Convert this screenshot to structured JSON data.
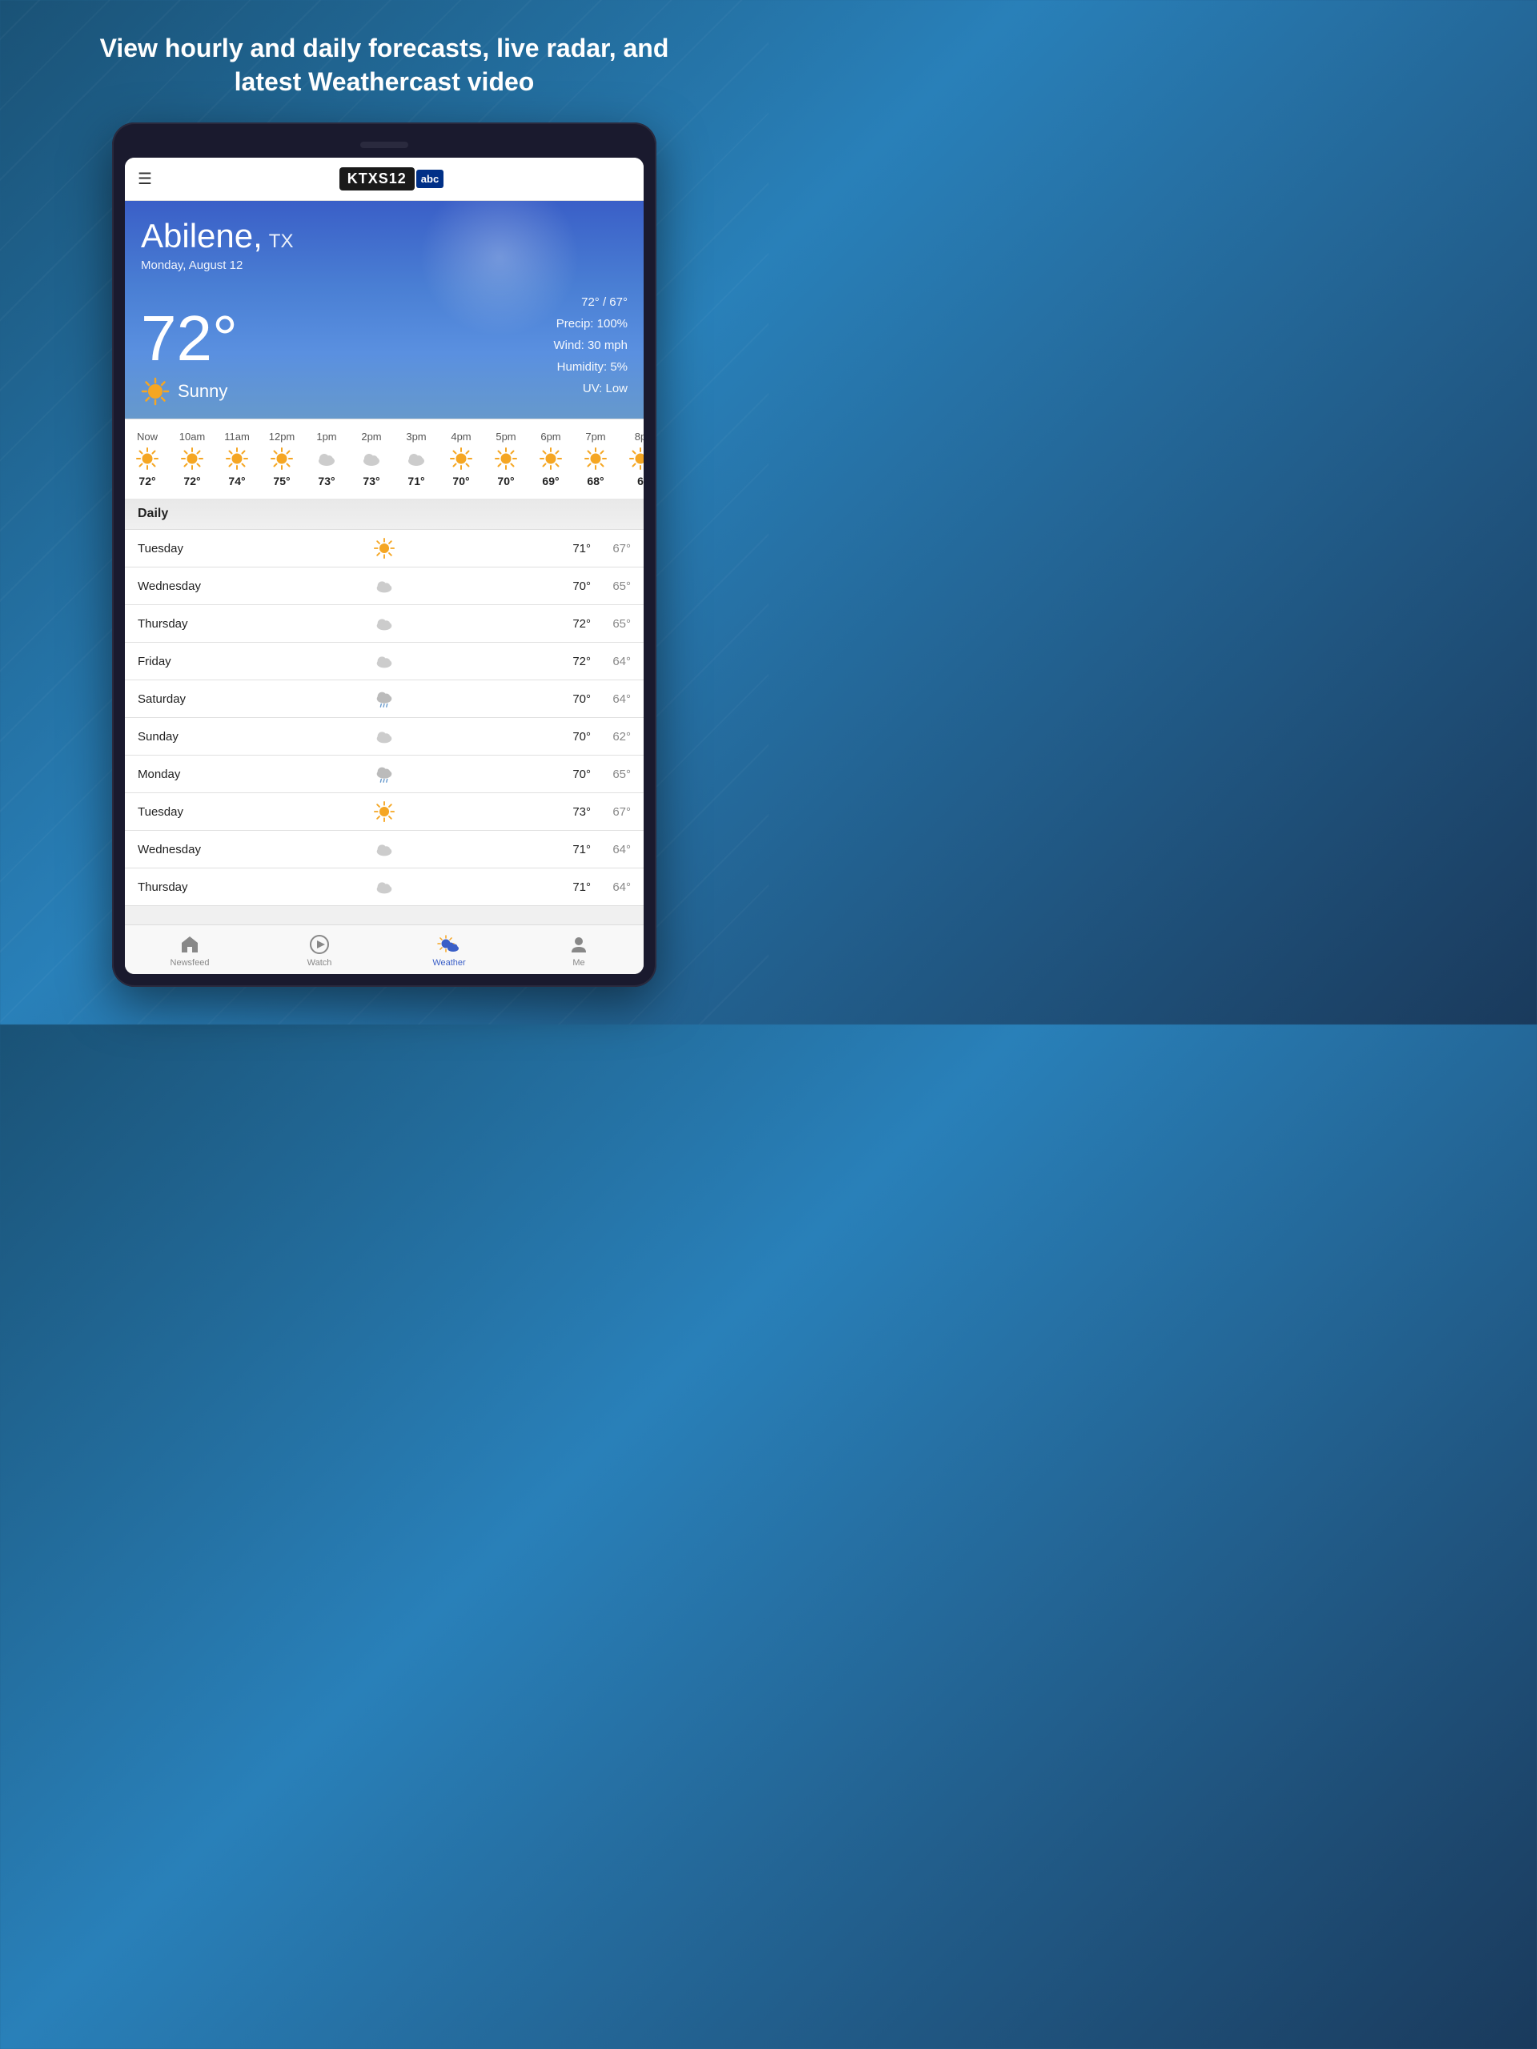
{
  "headline": "View hourly and daily forecasts, live radar,\nand latest Weathercast video",
  "header": {
    "menu_icon": "☰",
    "logo_main": "KTXS12",
    "logo_sub": "abc"
  },
  "weather": {
    "city": "Abilene,",
    "state": "TX",
    "date": "Monday, August 12",
    "temp": "72°",
    "condition": "Sunny",
    "high_low": "72° / 67°",
    "precip": "Precip: 100%",
    "wind": "Wind: 30 mph",
    "humidity": "Humidity: 5%",
    "uv": "UV: Low"
  },
  "hourly": [
    {
      "label": "Now",
      "temp": "72°",
      "type": "sun"
    },
    {
      "label": "10am",
      "temp": "72°",
      "type": "sun"
    },
    {
      "label": "11am",
      "temp": "74°",
      "type": "sun"
    },
    {
      "label": "12pm",
      "temp": "75°",
      "type": "sun"
    },
    {
      "label": "1pm",
      "temp": "73°",
      "type": "cloud"
    },
    {
      "label": "2pm",
      "temp": "73°",
      "type": "cloud"
    },
    {
      "label": "3pm",
      "temp": "71°",
      "type": "cloud"
    },
    {
      "label": "4pm",
      "temp": "70°",
      "type": "sun"
    },
    {
      "label": "5pm",
      "temp": "70°",
      "type": "sun"
    },
    {
      "label": "6pm",
      "temp": "69°",
      "type": "sun"
    },
    {
      "label": "7pm",
      "temp": "68°",
      "type": "sun"
    },
    {
      "label": "8p",
      "temp": "6",
      "type": "sun"
    }
  ],
  "daily_header": "Daily",
  "daily": [
    {
      "day": "Tuesday",
      "high": "71°",
      "low": "67°",
      "type": "sun"
    },
    {
      "day": "Wednesday",
      "high": "70°",
      "low": "65°",
      "type": "cloud"
    },
    {
      "day": "Thursday",
      "high": "72°",
      "low": "65°",
      "type": "cloud"
    },
    {
      "day": "Friday",
      "high": "72°",
      "low": "64°",
      "type": "cloud"
    },
    {
      "day": "Saturday",
      "high": "70°",
      "low": "64°",
      "type": "cloud-rain"
    },
    {
      "day": "Sunday",
      "high": "70°",
      "low": "62°",
      "type": "cloud"
    },
    {
      "day": "Monday",
      "high": "70°",
      "low": "65°",
      "type": "cloud-rain"
    },
    {
      "day": "Tuesday",
      "high": "73°",
      "low": "67°",
      "type": "sun"
    },
    {
      "day": "Wednesday",
      "high": "71°",
      "low": "64°",
      "type": "cloud"
    },
    {
      "day": "Thursday",
      "high": "71°",
      "low": "64°",
      "type": "cloud"
    }
  ],
  "nav": {
    "items": [
      {
        "label": "Newsfeed",
        "icon": "home",
        "active": false
      },
      {
        "label": "Watch",
        "icon": "play",
        "active": false
      },
      {
        "label": "Weather",
        "icon": "weather",
        "active": true
      },
      {
        "label": "Me",
        "icon": "person",
        "active": false
      }
    ]
  }
}
